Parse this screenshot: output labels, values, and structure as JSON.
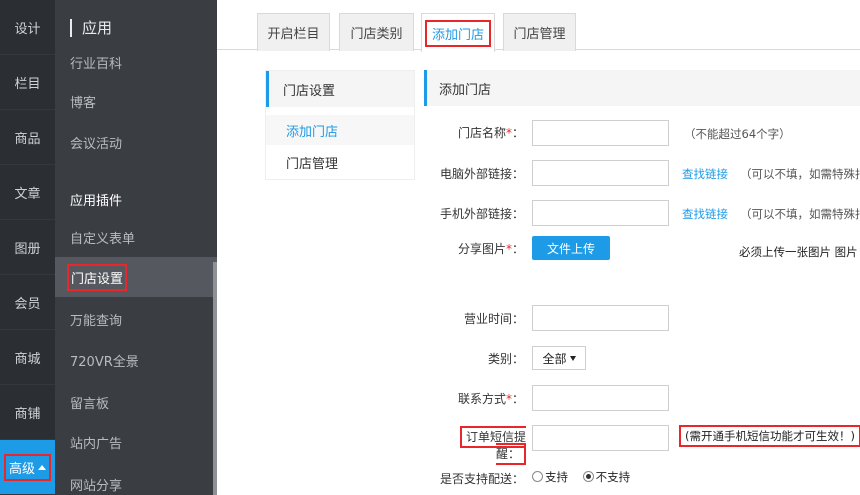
{
  "nav": {
    "items": [
      {
        "label": "设计"
      },
      {
        "label": "栏目"
      },
      {
        "label": "商品"
      },
      {
        "label": "文章"
      },
      {
        "label": "图册"
      },
      {
        "label": "会员"
      },
      {
        "label": "商城"
      },
      {
        "label": "商铺"
      },
      {
        "label": "高级"
      }
    ]
  },
  "submenu": {
    "title": "应用",
    "items": [
      {
        "label": "行业百科"
      },
      {
        "label": "博客"
      },
      {
        "label": "会议活动"
      },
      {
        "label": "应用插件"
      },
      {
        "label": "自定义表单"
      },
      {
        "label": "门店设置"
      },
      {
        "label": "万能查询"
      },
      {
        "label": "720VR全景"
      },
      {
        "label": "留言板"
      },
      {
        "label": "站内广告"
      },
      {
        "label": "网站分享"
      }
    ]
  },
  "tabs": [
    {
      "label": "开启栏目"
    },
    {
      "label": "门店类别"
    },
    {
      "label": "添加门店"
    },
    {
      "label": "门店管理"
    }
  ],
  "side_panel": {
    "title": "门店设置",
    "items": [
      {
        "label": "添加门店"
      },
      {
        "label": "门店管理"
      }
    ]
  },
  "form": {
    "title": "添加门店",
    "fields": {
      "store_name": {
        "label": "门店名称",
        "required": "*",
        "suffix": "：",
        "hint": "（不能超过64个字）"
      },
      "pc_link": {
        "label": "电脑外部链接：",
        "link": "查找链接",
        "hint": "（可以不填，如需特殊指"
      },
      "mobile_link": {
        "label": "手机外部链接：",
        "link": "查找链接",
        "hint": "（可以不填，如需特殊指"
      },
      "share_image": {
        "label": "分享图片",
        "required": "*",
        "suffix": "：",
        "button": "文件上传",
        "hint": "必须上传一张图片 图片"
      },
      "business_hours": {
        "label": "营业时间："
      },
      "category": {
        "label": "类别：",
        "value": "全部"
      },
      "contact": {
        "label": "联系方式",
        "required": "*",
        "suffix": "："
      },
      "sms_reminder": {
        "label": "订单短信提醒：",
        "hint": "(需开通手机短信功能才可生效！)"
      },
      "delivery": {
        "label": "是否支持配送：",
        "opt_yes": "支持",
        "opt_no": "不支持"
      }
    }
  }
}
